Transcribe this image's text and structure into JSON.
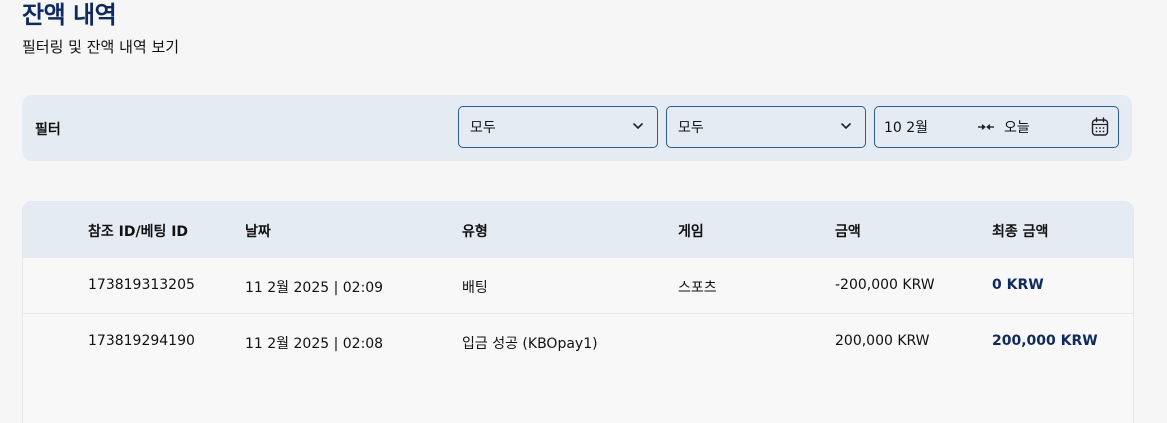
{
  "header": {
    "title": "잔액 내역",
    "subtitle": "필터링 및 잔액 내역 보기"
  },
  "filters": {
    "label": "필터",
    "select_1": {
      "value": "모두",
      "icon": "chevron-down-icon"
    },
    "select_2": {
      "value": "모두",
      "icon": "chevron-down-icon"
    },
    "date_range": {
      "from": "10 2월",
      "to": "오늘",
      "arrows_icon": "arrows-icon",
      "calendar_icon": "calendar-icon"
    }
  },
  "table": {
    "columns": [
      "참조 ID/베팅 ID",
      "날짜",
      "유형",
      "게임",
      "금액",
      "최종 금액"
    ],
    "rows": [
      [
        "173819313205",
        "11 2월 2025 | 02:09",
        "배팅",
        "스포츠",
        "-200,000 KRW",
        "0 KRW"
      ],
      [
        "173819294190",
        "11 2월 2025 | 02:08",
        "입금 성공 (KBOpay1)",
        "",
        "200,000 KRW",
        "200,000 KRW"
      ]
    ]
  },
  "colors": {
    "title": "#0f2a5f",
    "filter_bg": "#e5ebf2",
    "select_border": "#2d5b95",
    "table_header_bg": "#e5ebf2",
    "page_bg": "#f6f6f6"
  }
}
